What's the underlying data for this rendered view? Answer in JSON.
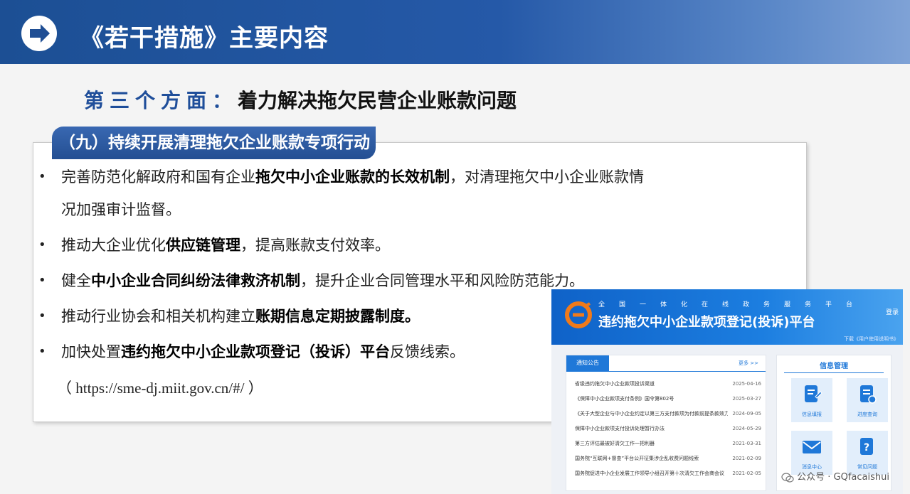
{
  "header": {
    "title": "《若干措施》主要内容"
  },
  "subtitle": {
    "prefix": "第三个方面：",
    "main": "着力解决拖欠民营企业账款问题"
  },
  "section": {
    "label": "（九）持续开展清理拖欠企业账款专项行动"
  },
  "bullets": [
    {
      "segments": [
        {
          "text": "完善防范化解政府和国有企业",
          "bold": false
        },
        {
          "text": "拖欠中小企业账款的长效机制",
          "bold": true
        },
        {
          "text": "，对清理拖欠中小企业账款情况加强审计监督。",
          "bold": false
        }
      ]
    },
    {
      "segments": [
        {
          "text": "推动大企业优化",
          "bold": false
        },
        {
          "text": "供应链管理",
          "bold": true
        },
        {
          "text": "，提高账款支付效率。",
          "bold": false
        }
      ]
    },
    {
      "segments": [
        {
          "text": "健全",
          "bold": false
        },
        {
          "text": "中小企业合同纠纷法律救济机制",
          "bold": true
        },
        {
          "text": "，提升企业合同管理水平和风险防范能力。",
          "bold": false
        }
      ]
    },
    {
      "segments": [
        {
          "text": "推动行业协会和相关机构建立",
          "bold": false
        },
        {
          "text": "账期信息定期披露制度。",
          "bold": true
        }
      ]
    },
    {
      "segments": [
        {
          "text": "加快处置",
          "bold": false
        },
        {
          "text": "违约拖欠中小企业款项登记（投诉）平台",
          "bold": true
        },
        {
          "text": "反馈线索。",
          "bold": false
        }
      ]
    }
  ],
  "url_line": "（ https://sme-dj.miit.gov.cn/#/ ）",
  "portal": {
    "subtitle": "全国一体化在线政务服务平台",
    "title": "违约拖欠中小企业款项登记(投诉)平台",
    "login": "登录",
    "download": "下载《用户使用说明书》",
    "notice_tab": "通知公告",
    "more": "更多 >>",
    "news": [
      {
        "title": "省级违约拖欠中小企业款项投诉渠道",
        "date": "2025-04-16"
      },
      {
        "title": "《保障中小企业款项支付条例》国令第802号",
        "date": "2025-03-27"
      },
      {
        "title": "《关于大型企业与中小企业约定以第三方支付款项为付款前提条款效力…",
        "date": "2024-09-05"
      },
      {
        "title": "保障中小企业款项支付投诉处理暂行办法",
        "date": "2024-05-29"
      },
      {
        "title": "第三方评估最被好清欠工作一把利器",
        "date": "2021-03-31"
      },
      {
        "title": "国务院“互联网+督查”平台公开征集涉企乱收费问题线索",
        "date": "2021-02-09"
      },
      {
        "title": "国务院促进中小企业发展工作领导小组召开第十次清欠工作会商会议",
        "date": "2021-02-05"
      }
    ],
    "info_title": "信息管理",
    "tiles": [
      {
        "label": "信息填报",
        "icon": "document-edit-icon"
      },
      {
        "label": "进度查询",
        "icon": "document-list-icon"
      },
      {
        "label": "消息中心",
        "icon": "mail-icon"
      },
      {
        "label": "常见问题",
        "icon": "question-document-icon"
      }
    ]
  },
  "watermark": "公众号 · GQfacaishui"
}
